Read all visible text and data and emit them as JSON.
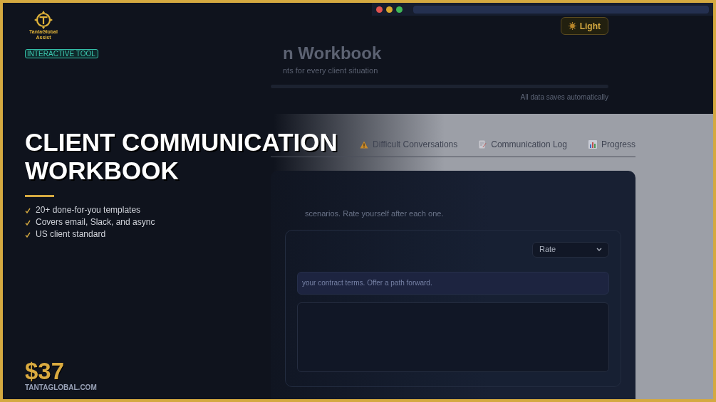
{
  "promo": {
    "brand_lines": [
      "TantaGlobal",
      "Assist"
    ],
    "badge": "INTERACTIVE TOOL",
    "title_lines": [
      "CLIENT COMMUNICATION",
      "WORKBOOK"
    ],
    "features": [
      "20+ done-for-you templates",
      "Covers email, Slack, and async",
      "US client standard"
    ],
    "price": "$37",
    "site": "TANTAGLOBAL.COM"
  },
  "app": {
    "theme_button": "Light",
    "title": "n Workbook",
    "subtitle": "nts for every client situation",
    "save_note": "All data saves automatically",
    "tabs": [
      {
        "kind": "warning",
        "label": "Difficult Conversations",
        "selected": false
      },
      {
        "kind": "memo",
        "label": "Communication Log",
        "selected": false
      },
      {
        "kind": "chart",
        "label": "Progress",
        "selected": false
      }
    ],
    "card": {
      "intro": "scenarios. Rate yourself after each one.",
      "rating_select": "Rate",
      "prompt": "your contract terms. Offer a path forward."
    }
  }
}
